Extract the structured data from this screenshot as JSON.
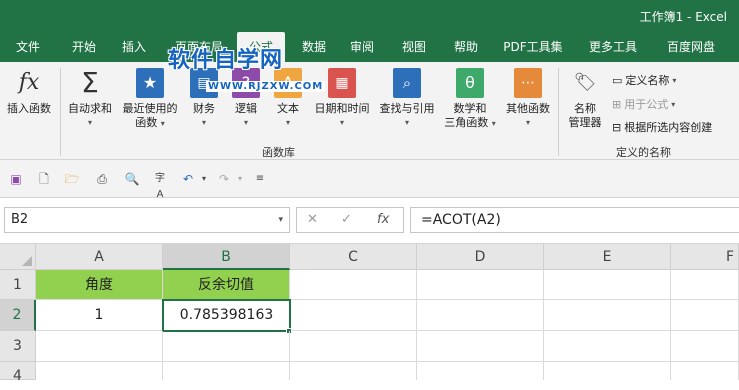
{
  "window": {
    "title": "工作簿1  -  Excel"
  },
  "tabs": [
    {
      "label": "文件"
    },
    {
      "label": "开始"
    },
    {
      "label": "插入"
    },
    {
      "label": "页面布局"
    },
    {
      "label": "公式"
    },
    {
      "label": "数据"
    },
    {
      "label": "审阅"
    },
    {
      "label": "视图"
    },
    {
      "label": "帮助"
    },
    {
      "label": "PDF工具集"
    },
    {
      "label": "更多工具"
    },
    {
      "label": "百度网盘"
    }
  ],
  "watermark": {
    "text": "软件自学网",
    "url": "WWW.RJZXW.COM"
  },
  "ribbon": {
    "insert_function": {
      "label": "插入函数",
      "icon": "fx"
    },
    "autosum": {
      "label": "自动求和",
      "icon": "Σ"
    },
    "recent": {
      "label1": "最近使用的",
      "label2": "函数"
    },
    "financial": {
      "label": "财务"
    },
    "logical": {
      "label": "逻辑"
    },
    "text": {
      "label": "文本"
    },
    "datetime": {
      "label": "日期和时间"
    },
    "lookup": {
      "label": "查找与引用"
    },
    "math": {
      "label1": "数学和",
      "label2": "三角函数",
      "icon": "θ"
    },
    "more": {
      "label": "其他函数"
    },
    "group_function_library": "函数库",
    "name_manager": {
      "label1": "名称",
      "label2": "管理器"
    },
    "define_name": "定义名称",
    "use_in_formula": "用于公式",
    "create_from_selection": "根据所选内容创建",
    "group_defined_names": "定义的名称",
    "colors": {
      "accent": "#217346",
      "header_green": "#92d050"
    }
  },
  "formula_bar": {
    "name_box": "B2",
    "formula": "=ACOT(A2)",
    "fx": "fx"
  },
  "grid": {
    "columns": [
      "A",
      "B",
      "C",
      "D",
      "E",
      "F"
    ],
    "rows": [
      "1",
      "2",
      "3",
      "4"
    ],
    "cells": {
      "A1": "角度",
      "B1": "反余切值",
      "A2": "1",
      "B2": "0.785398163"
    }
  }
}
